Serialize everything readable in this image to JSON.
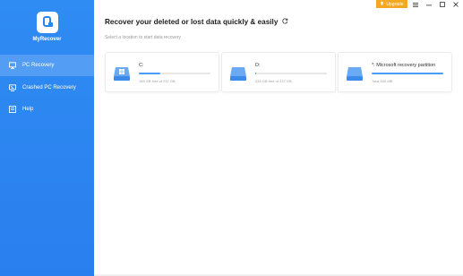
{
  "app": {
    "name": "MyRecover"
  },
  "colors": {
    "sidebar": "#2a85f2",
    "accent": "#4a9df5",
    "upgrade": "#f5a623"
  },
  "topbar": {
    "upgrade_label": "Upgrade",
    "icons": [
      "upgrade-icon",
      "menu-icon",
      "minimize-icon",
      "maximize-icon",
      "close-icon"
    ]
  },
  "sidebar": {
    "items": [
      {
        "label": "PC Recovery",
        "icon": "monitor-icon",
        "active": true
      },
      {
        "label": "Crashed PC Recovery",
        "icon": "crashed-pc-icon",
        "active": false
      },
      {
        "label": "Help",
        "icon": "help-icon",
        "active": false
      }
    ]
  },
  "main": {
    "title": "Recover your deleted or lost data quickly & easily",
    "subtitle": "Select a location to start data recovery"
  },
  "drives": [
    {
      "name": "C:",
      "size": "165 GB free of 237 GB",
      "usage": 0.3,
      "icon": "windows-drive-icon"
    },
    {
      "name": "D:",
      "size": "235 GB free of 237 GB",
      "usage": 0.01,
      "icon": "drive-icon"
    },
    {
      "name": "*: Microsoft recovery partition",
      "size": "Total 500 MB",
      "usage": 1.0,
      "icon": "drive-icon"
    }
  ]
}
